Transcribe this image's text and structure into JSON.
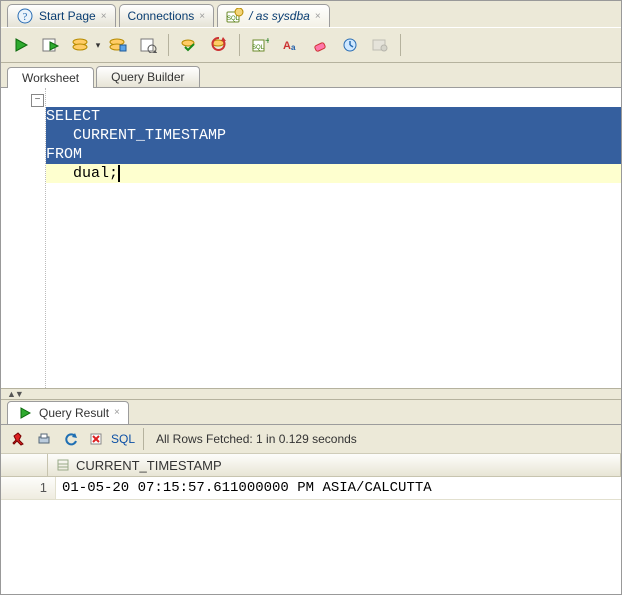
{
  "topTabs": {
    "startPage": "Start Page",
    "connections": "Connections",
    "session": "/ as sysdba"
  },
  "wsTabs": {
    "worksheet": "Worksheet",
    "queryBuilder": "Query Builder"
  },
  "sql": {
    "l1": "SELECT",
    "l2": "   CURRENT_TIMESTAMP",
    "l3": "FROM",
    "l4": "   dual;"
  },
  "resultTab": "Query Result",
  "resultBar": {
    "sql": "SQL",
    "status": "All Rows Fetched: 1 in 0.129 seconds"
  },
  "grid": {
    "col1": "CURRENT_TIMESTAMP",
    "row1num": "1",
    "row1val": "01-05-20 07:15:57.611000000 PM ASIA/CALCUTTA"
  }
}
